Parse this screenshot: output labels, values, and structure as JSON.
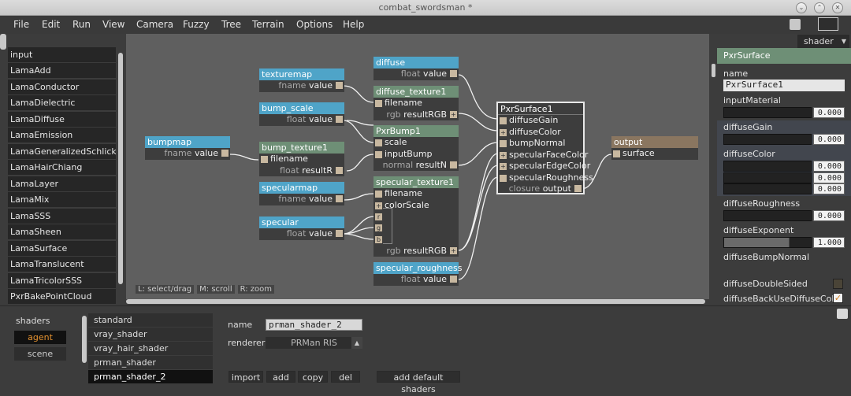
{
  "window": {
    "title": "combat_swordsman *"
  },
  "menu": [
    "File",
    "Edit",
    "Run",
    "View",
    "Camera",
    "Fuzzy",
    "Tree",
    "Terrain",
    "Options",
    "Help"
  ],
  "node_list": [
    "input",
    "LamaAdd",
    "LamaConductor",
    "LamaDielectric",
    "LamaDiffuse",
    "LamaEmission",
    "LamaGeneralizedSchlick",
    "LamaHairChiang",
    "LamaLayer",
    "LamaMix",
    "LamaSSS",
    "LamaSheen",
    "LamaSurface",
    "LamaTranslucent",
    "LamaTricolorSSS",
    "PxrBakePointCloud"
  ],
  "graph": {
    "hint": [
      "L: select/drag",
      "M: scroll",
      "R: zoom"
    ],
    "nodes": {
      "texturemap": {
        "title": "texturemap",
        "port_type": "fname",
        "port": "value"
      },
      "bump_scale": {
        "title": "bump_scale",
        "port_type": "float",
        "port": "value"
      },
      "bumpmap": {
        "title": "bumpmap",
        "port_type": "fname",
        "port": "value"
      },
      "bump_texture1": {
        "title": "bump_texture1",
        "in": "filename",
        "port_type": "float",
        "port": "resultR"
      },
      "specularmap": {
        "title": "specularmap",
        "port_type": "fname",
        "port": "value"
      },
      "specular": {
        "title": "specular",
        "port_type": "float",
        "port": "value"
      },
      "diffuse": {
        "title": "diffuse",
        "port_type": "float",
        "port": "value"
      },
      "diffuse_texture1": {
        "title": "diffuse_texture1",
        "in": "filename",
        "port_type": "rgb",
        "port": "resultRGB"
      },
      "pxrbump1": {
        "title": "PxrBump1",
        "in1": "scale",
        "in2": "inputBump",
        "port_type": "normal",
        "port": "resultN"
      },
      "specular_texture1": {
        "title": "specular_texture1",
        "in1": "filename",
        "in2": "colorScale",
        "r": "r",
        "g": "g",
        "b": "b",
        "port_type": "rgb",
        "port": "resultRGB"
      },
      "specular_roughness": {
        "title": "specular_roughness",
        "port_type": "float",
        "port": "value"
      },
      "pxrsurface1": {
        "title": "PxrSurface1",
        "ports": [
          "diffuseGain",
          "diffuseColor",
          "bumpNormal",
          "specularFaceColor",
          "specularEdgeColor",
          "specularRoughness"
        ],
        "port_type": "closure",
        "port": "output"
      },
      "output": {
        "title": "output",
        "in": "surface"
      }
    }
  },
  "props": {
    "combo": "shader",
    "header": "PxrSurface",
    "name_label": "name",
    "name_value": "PxrSurface1",
    "input_material": {
      "label": "inputMaterial",
      "value": "0.000"
    },
    "diffuse_gain": {
      "label": "diffuseGain",
      "value": "0.000"
    },
    "diffuse_color": {
      "label": "diffuseColor",
      "values": [
        "0.000",
        "0.000",
        "0.000"
      ]
    },
    "diffuse_roughness": {
      "label": "diffuseRoughness",
      "value": "0.000"
    },
    "diffuse_exponent": {
      "label": "diffuseExponent",
      "value": "1.000"
    },
    "diffuse_bump_normal": {
      "label": "diffuseBumpNormal"
    },
    "diffuse_double_sided": {
      "label": "diffuseDoubleSided",
      "checked": false
    },
    "diffuse_back_use": {
      "label": "diffuseBackUseDiffuseColor",
      "checked": true
    }
  },
  "bottom": {
    "shaders_label": "shaders",
    "agent": "agent",
    "scene": "scene",
    "shader_list": [
      "standard",
      "vray_shader",
      "vray_hair_shader",
      "prman_shader",
      "prman_shader_2"
    ],
    "name_label": "name",
    "name_value": "prman_shader_2",
    "renderer_label": "renderer",
    "renderer_value": "PRMan RIS",
    "import": "import",
    "add": "add",
    "copy": "copy",
    "del": "del",
    "add_default": "add default shaders"
  },
  "colors": {
    "node_blue": "#4fa4c8",
    "node_green": "#6e8f76",
    "node_brown": "#8a7660",
    "accent": "#e5922f"
  }
}
